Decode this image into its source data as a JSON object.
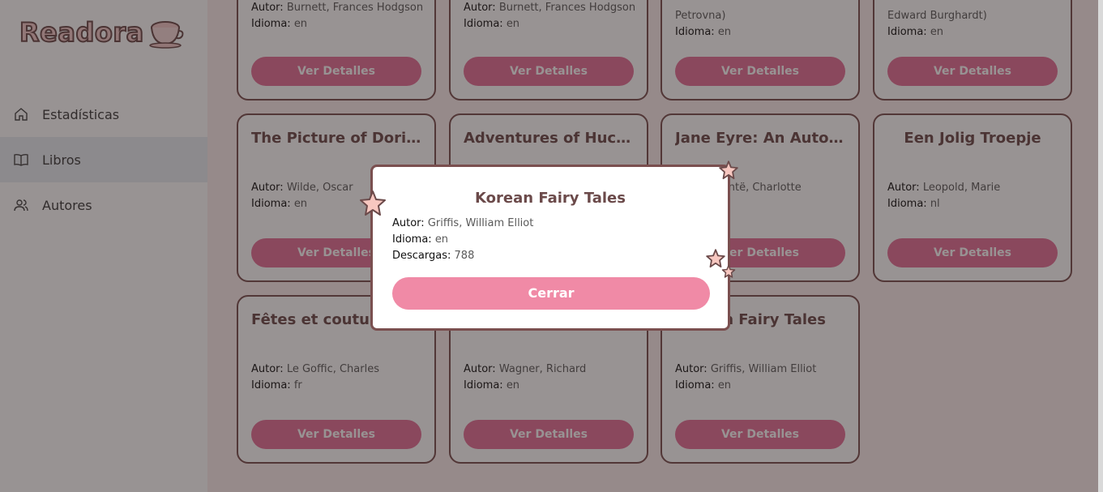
{
  "app": {
    "logo_text": "Readora",
    "logo_icon": "teacup-icon"
  },
  "sidebar": {
    "items": [
      {
        "label": "Estadísticas",
        "icon": "home-icon",
        "active": false
      },
      {
        "label": "Libros",
        "icon": "book-icon",
        "active": true
      },
      {
        "label": "Autores",
        "icon": "users-icon",
        "active": false
      }
    ]
  },
  "labels": {
    "author": "Autor:",
    "language": "Idioma:",
    "downloads": "Descargas:",
    "details_button": "Ver Detalles",
    "close_button": "Cerrar"
  },
  "books_top_row": [
    {
      "author_tail": "Burnett, Frances Hodgson",
      "language": "en"
    },
    {
      "author_tail": "Burnett, Frances Hodgson",
      "language": "en"
    },
    {
      "author_tail": "Petrovna)",
      "language": "en"
    },
    {
      "author_tail": "Edward Burghardt)",
      "language": "en"
    }
  ],
  "books_row2": [
    {
      "title": "The Picture of Doria...",
      "author": "Wilde, Oscar",
      "language": "en"
    },
    {
      "title": "Adventures of Huckl...",
      "author": "",
      "language": ""
    },
    {
      "title": "Jane Eyre: An Autobi...",
      "author": "Brontë, Charlotte",
      "language": ""
    },
    {
      "title": "Een Jolig Troepje",
      "author": "Leopold, Marie",
      "language": "nl"
    }
  ],
  "books_row3": [
    {
      "title": "Fêtes et coutum",
      "author": "Le Goffic, Charles",
      "language": "fr"
    },
    {
      "title": "",
      "author": "Wagner, Richard",
      "language": "en"
    },
    {
      "title": "Korean Fairy Tales",
      "author": "Griffis, William Elliot",
      "language": "en"
    }
  ],
  "modal": {
    "title": "Korean Fairy Tales",
    "author": "Griffis, William Elliot",
    "language": "en",
    "downloads": "788"
  },
  "colors": {
    "accent": "#e56f98",
    "brown": "#7a4f4f",
    "modal_button": "#f08aa6"
  }
}
